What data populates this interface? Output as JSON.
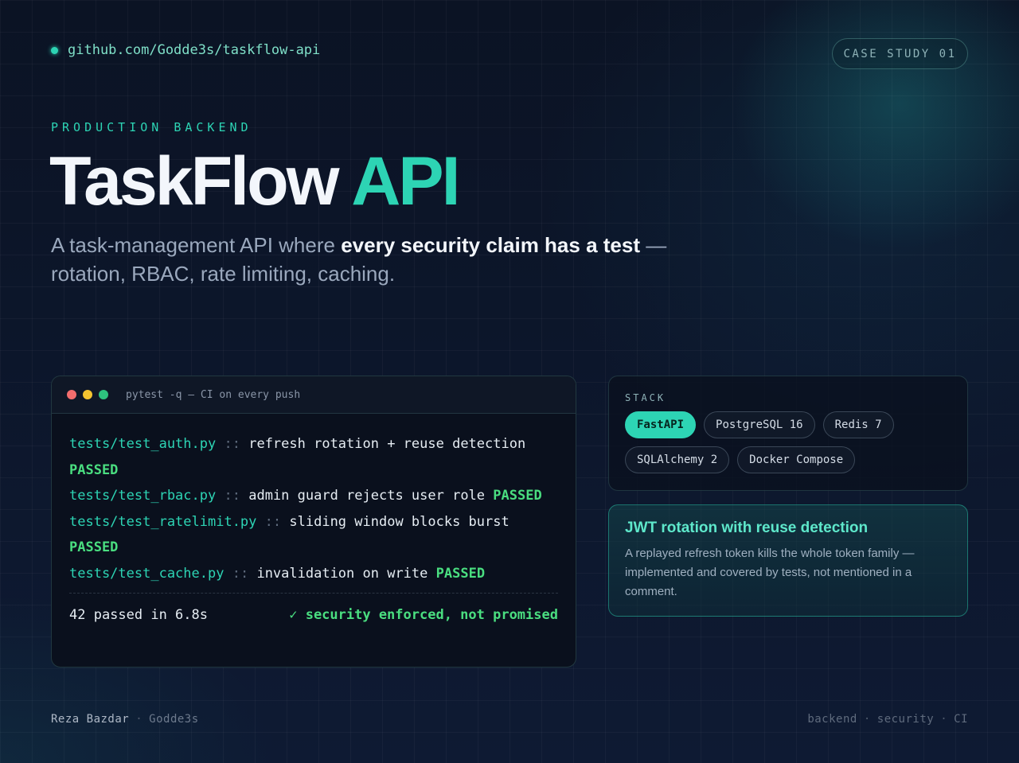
{
  "repo": {
    "url": "github.com/Godde3s/taskflow-api"
  },
  "badge": {
    "label": "CASE STUDY 01"
  },
  "hero": {
    "eyebrow": "PRODUCTION BACKEND",
    "title_main": "TaskFlow",
    "title_accent": "API",
    "subtitle_pre": "A task-management API where ",
    "subtitle_bold": "every security claim has a test",
    "subtitle_post": " — rotation, RBAC, rate limiting, caching."
  },
  "terminal": {
    "title": "pytest -q — CI on every push",
    "lines": [
      {
        "file": "tests/test_auth.py",
        "sep": "::",
        "desc": "refresh rotation + reuse detection",
        "status": "PASSED"
      },
      {
        "file": "tests/test_rbac.py",
        "sep": "::",
        "desc": "admin guard rejects user role",
        "status": "PASSED"
      },
      {
        "file": "tests/test_ratelimit.py",
        "sep": "::",
        "desc": "sliding window blocks burst",
        "status": "PASSED"
      },
      {
        "file": "tests/test_cache.py",
        "sep": "::",
        "desc": "invalidation on write",
        "status": "PASSED"
      }
    ],
    "summary": "42 passed in 6.8s",
    "claim": "✓ security enforced, not promised"
  },
  "stack": {
    "label": "STACK",
    "chips": [
      "FastAPI",
      "PostgreSQL 16",
      "Redis 7",
      "SQLAlchemy 2",
      "Docker Compose"
    ]
  },
  "feature": {
    "title": "JWT rotation with reuse detection",
    "body": "A replayed refresh token kills the whole token family — implemented and covered by tests, not mentioned in a comment."
  },
  "footer": {
    "author": "Reza Bazdar",
    "handle": "Godde3s",
    "tags": [
      "backend",
      "security",
      "CI"
    ]
  },
  "colors": {
    "accent": "#2dd4b4",
    "passed": "#4ade80",
    "background": "#0c1527"
  }
}
